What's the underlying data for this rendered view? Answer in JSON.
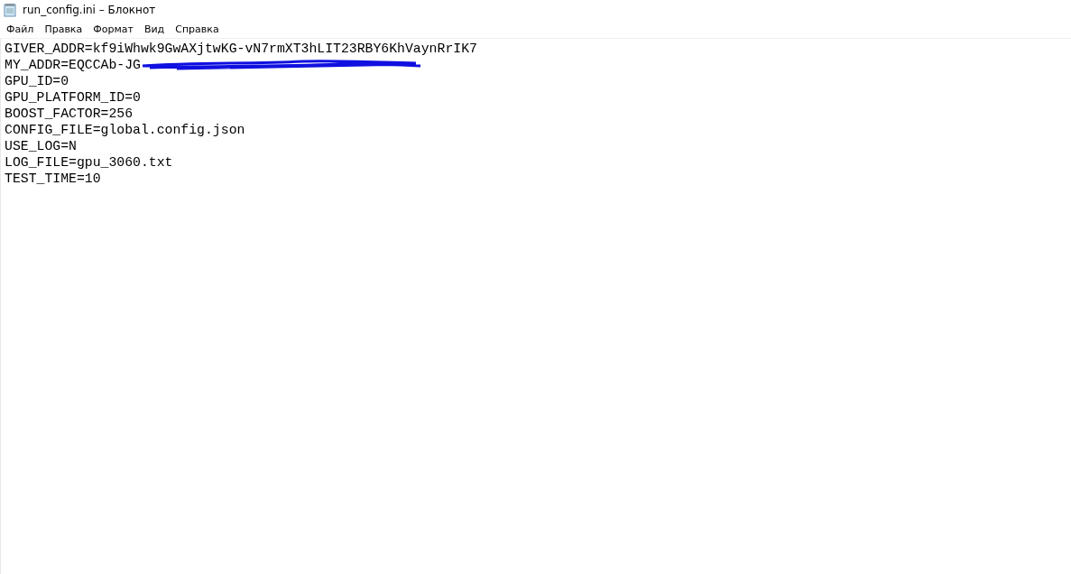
{
  "window": {
    "title": "run_config.ini – Блокнот"
  },
  "menu": [
    "Файл",
    "Правка",
    "Формат",
    "Вид",
    "Справка"
  ],
  "editor": {
    "lines": [
      {
        "kind": "text",
        "text": "GIVER_ADDR=kf9iWhwk9GwAXjtwKG-vN7rmXT3hLIT23RBY6KhVaynRrIK7"
      },
      {
        "kind": "redacted",
        "text": "MY_ADDR=EQCCAb-JG"
      },
      {
        "kind": "text",
        "text": "GPU_ID=0"
      },
      {
        "kind": "text",
        "text": "GPU_PLATFORM_ID=0"
      },
      {
        "kind": "text",
        "text": "BOOST_FACTOR=256"
      },
      {
        "kind": "text",
        "text": "CONFIG_FILE=global.config.json"
      },
      {
        "kind": "text",
        "text": "USE_LOG=N"
      },
      {
        "kind": "text",
        "text": "LOG_FILE=gpu_3060.txt"
      },
      {
        "kind": "text",
        "text": "TEST_TIME=10"
      }
    ]
  }
}
